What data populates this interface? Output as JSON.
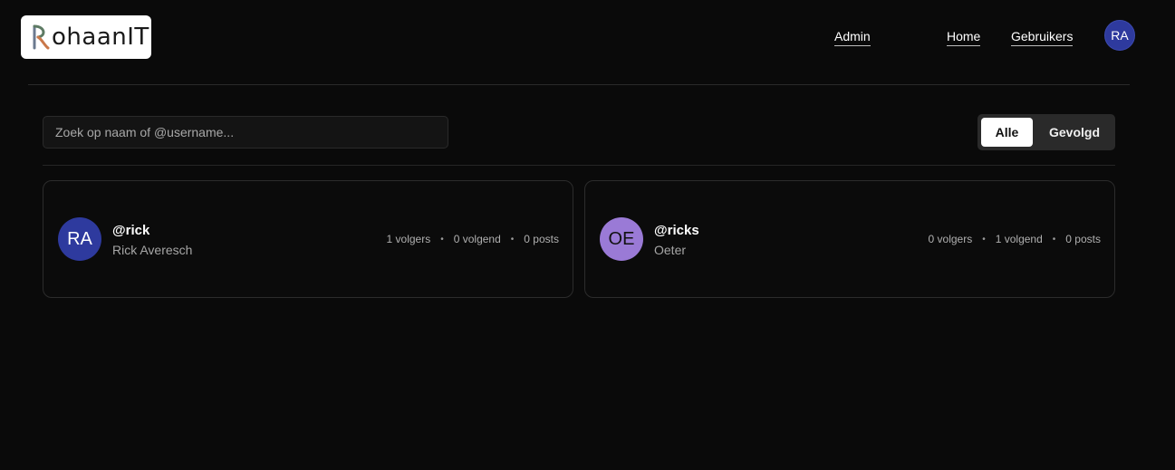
{
  "header": {
    "logo_text": "ohaanIT",
    "nav": {
      "admin": "Admin",
      "home": "Home",
      "users": "Gebruikers"
    },
    "avatar_initials": "RA"
  },
  "toolbar": {
    "search_placeholder": "Zoek op naam of @username...",
    "filters": {
      "all": "Alle",
      "followed": "Gevolgd"
    },
    "active_filter": "Alle"
  },
  "users": [
    {
      "initials": "RA",
      "username": "@rick",
      "name": "Rick Averesch",
      "followers": "1 volgers",
      "following": "0 volgend",
      "posts": "0 posts",
      "avatar_color": "#2e3a9e"
    },
    {
      "initials": "OE",
      "username": "@ricks",
      "name": "Oeter",
      "followers": "0 volgers",
      "following": "1 volgend",
      "posts": "0 posts",
      "avatar_color": "#9a7ad6"
    }
  ],
  "colors": {
    "background": "#0a0a0a",
    "accent_blue": "#2e3a9e",
    "accent_purple": "#9a7ad6"
  }
}
